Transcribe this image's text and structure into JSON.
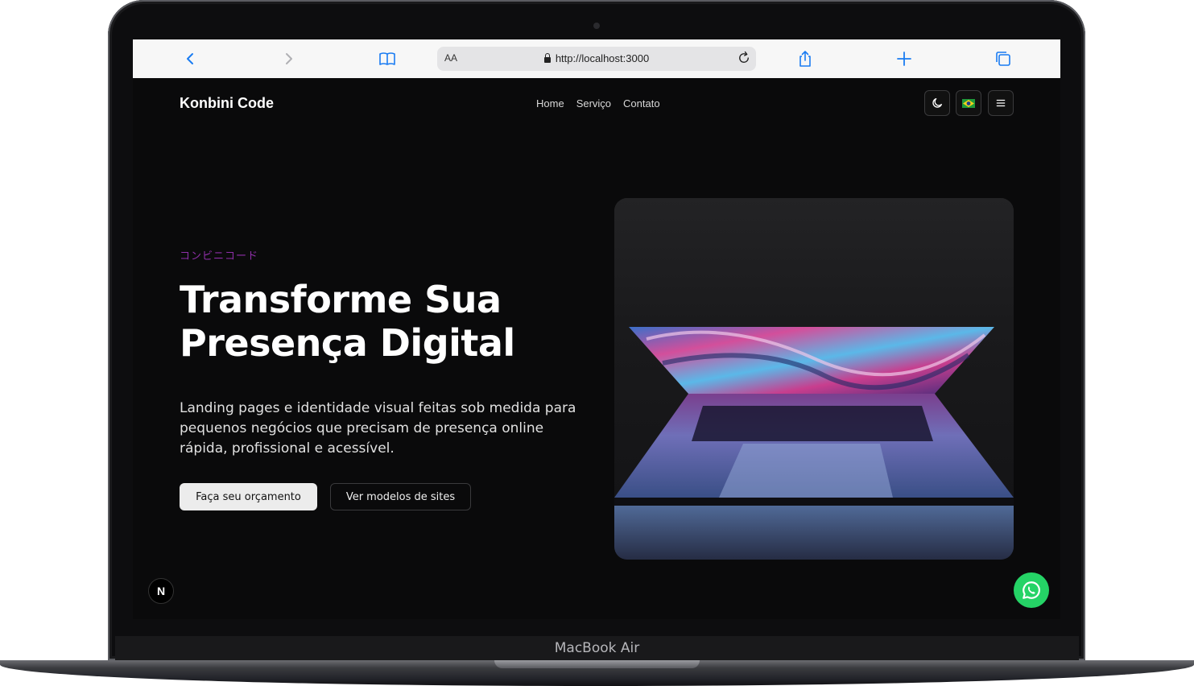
{
  "device": {
    "label": "MacBook Air"
  },
  "browser": {
    "reader_label": "AA",
    "url": "http://localhost:3000"
  },
  "site": {
    "brand": "Konbini Code",
    "nav": [
      "Home",
      "Serviço",
      "Contato"
    ],
    "controls": {
      "theme_icon": "moon-icon",
      "language_icon": "brazil-flag-icon",
      "menu_icon": "hamburger-menu-icon"
    }
  },
  "hero": {
    "kicker": "コンビニコード",
    "title_line1": "Transforme Sua",
    "title_line2": "Presença Digital",
    "subtitle": "Landing pages e identidade visual feitas sob medida para pequenos negócios que precisam de presença online rápida, profissional e acessível.",
    "primary_cta": "Faça seu orçamento",
    "secondary_cta": "Ver modelos de sites"
  },
  "floating": {
    "dev_badge": "N",
    "whatsapp_icon": "whatsapp-icon"
  },
  "colors": {
    "background": "#0a0a0b",
    "accent_kicker": "#8e2fa8",
    "whatsapp": "#25d366",
    "safari_blue": "#1a7cf2"
  }
}
